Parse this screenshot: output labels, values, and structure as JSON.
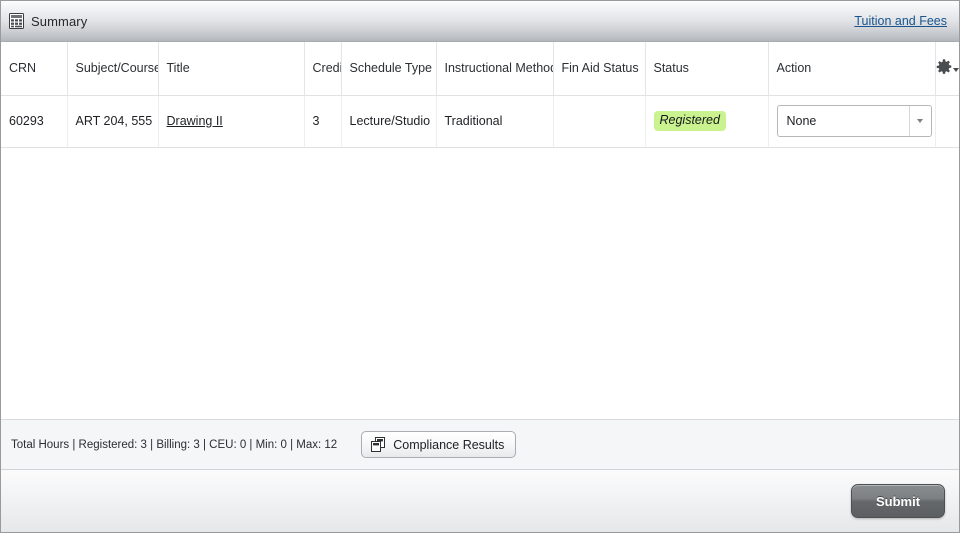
{
  "header": {
    "icon": "table-grid-icon",
    "title": "Summary",
    "tuition_link": "Tuition and Fees"
  },
  "table": {
    "gear_icon": "gear-icon",
    "columns": [
      {
        "key": "crn",
        "label": "CRN"
      },
      {
        "key": "subject",
        "label": "Subject/Course"
      },
      {
        "key": "title",
        "label": "Title"
      },
      {
        "key": "credits",
        "label": "Credit Hours"
      },
      {
        "key": "schedule",
        "label": "Schedule Type"
      },
      {
        "key": "method",
        "label": "Instructional Method"
      },
      {
        "key": "finaid",
        "label": "Fin Aid Status"
      },
      {
        "key": "status",
        "label": "Status"
      },
      {
        "key": "action",
        "label": "Action"
      }
    ],
    "rows": [
      {
        "crn": "60293",
        "subject": "ART 204, 555",
        "title": "Drawing II",
        "credits": "3",
        "schedule": "Lecture/Studio",
        "method": "Traditional",
        "finaid": "",
        "status": "Registered",
        "action": "None"
      }
    ]
  },
  "totals": {
    "text": "Total Hours | Registered: 3 | Billing: 3 | CEU: 0 | Min: 0 | Max: 12",
    "compliance_label": "Compliance Results",
    "compliance_icon": "copy-documents-icon"
  },
  "footer": {
    "submit_label": "Submit"
  },
  "colors": {
    "link": "#18558f",
    "status_badge_bg": "#caf28f",
    "panel_header_end": "#b3b7bc",
    "totals_bar_bg": "#f4f6f8",
    "submit_bg": "#6b6e71"
  }
}
